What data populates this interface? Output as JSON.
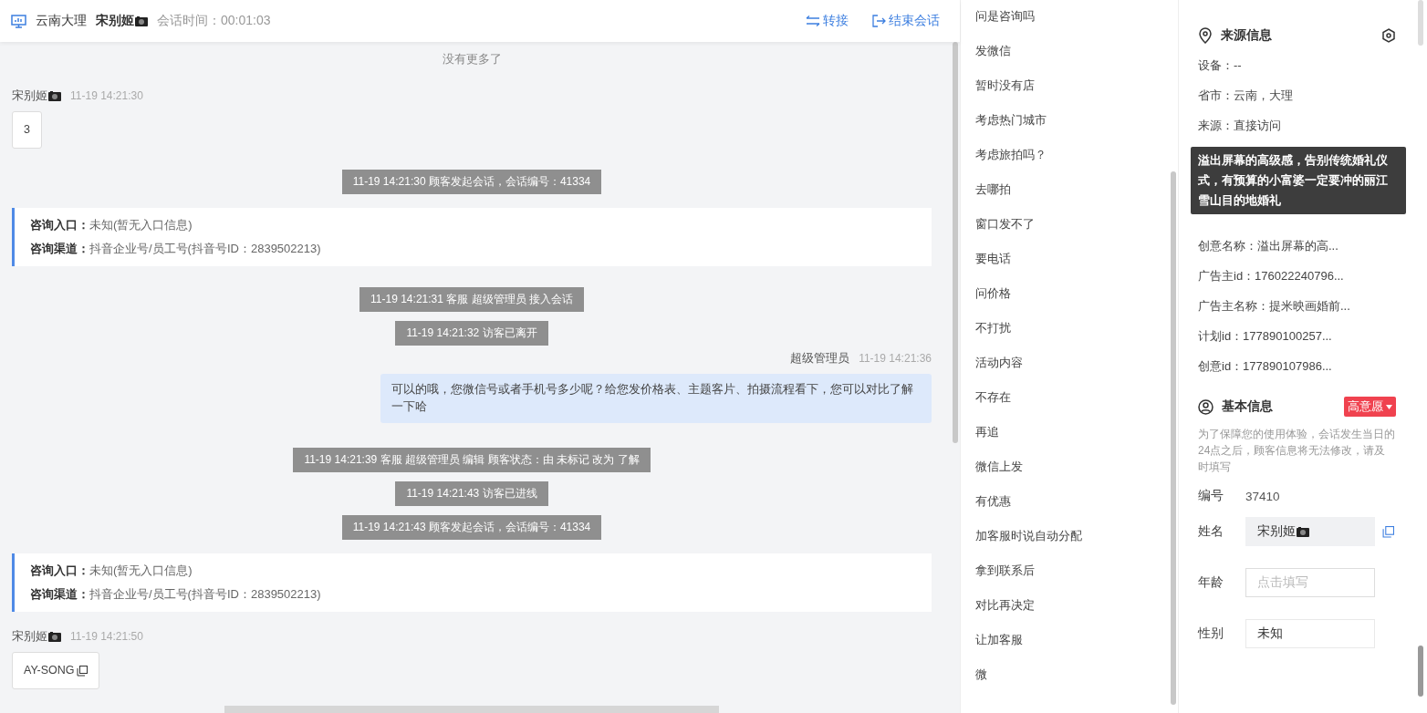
{
  "header": {
    "location": "云南大理",
    "visitor": "宋别姬",
    "duration_label": "会话时间：",
    "duration": "00:01:03",
    "actions": [
      {
        "kind": "transfer",
        "label": "转接"
      },
      {
        "kind": "end",
        "label": "结束会话"
      }
    ]
  },
  "messages": [
    {
      "kind": "notice",
      "text": "没有更多了"
    },
    {
      "kind": "customer",
      "name": "宋别姬",
      "time": "11-19 14:21:30",
      "text": "3",
      "copy": false
    },
    {
      "kind": "system",
      "text": "11-19 14:21:30 顾客发起会话，会话编号：41334"
    },
    {
      "kind": "entry",
      "lines": [
        {
          "label": "咨询入口：",
          "value": "未知(暂无入口信息)"
        },
        {
          "label": "咨询渠道：",
          "value": "抖音企业号/员工号(抖音号ID：2839502213)"
        }
      ]
    },
    {
      "kind": "system",
      "text": "11-19 14:21:31 客服 超级管理员 接入会话"
    },
    {
      "kind": "system",
      "text": "11-19 14:21:32 访客已离开"
    },
    {
      "kind": "agent",
      "name": "超级管理员",
      "time": "11-19 14:21:36",
      "text": "可以的哦，您微信号或者手机号多少呢？给您发价格表、主题客片、拍摄流程看下，您可以对比了解一下哈"
    },
    {
      "kind": "system",
      "text": "11-19 14:21:39 客服 超级管理员 编辑 顾客状态：由 未标记 改为 了解"
    },
    {
      "kind": "system",
      "text": "11-19 14:21:43 访客已进线"
    },
    {
      "kind": "system",
      "text": "11-19 14:21:43 顾客发起会话，会话编号：41334"
    },
    {
      "kind": "entry",
      "lines": [
        {
          "label": "咨询入口：",
          "value": "未知(暂无入口信息)"
        },
        {
          "label": "咨询渠道：",
          "value": "抖音企业号/员工号(抖音号ID：2839502213)"
        }
      ]
    },
    {
      "kind": "customer",
      "name": "宋别姬",
      "time": "11-19 14:21:50",
      "text": "AY-SONG",
      "copy": true
    },
    {
      "kind": "cut"
    }
  ],
  "quick_replies": [
    "问是咨询吗",
    "发微信",
    "暂时没有店",
    "考虑热门城市",
    "考虑旅拍吗？",
    "去哪拍",
    "窗口发不了",
    "要电话",
    "问价格",
    "不打扰",
    "活动内容",
    "不存在",
    "再追",
    "微信上发",
    "有优惠",
    "加客服时说自动分配",
    "拿到联系后",
    "对比再决定",
    "让加客服",
    "微"
  ],
  "source_info": {
    "title": "来源信息",
    "rows_before": [
      "设备：--",
      "省市：云南，大理",
      "来源：直接访问"
    ],
    "tooltip": "溢出屏幕的高级感，告别传统婚礼仪式，有预算的小富婆一定要冲的丽江雪山目的地婚礼",
    "rows_after": [
      "创意名称：溢出屏幕的高...",
      "广告主id：176022240796...",
      "广告主名称：提米映画婚前...",
      "计划id：177890100257...",
      "创意id：177890107986..."
    ]
  },
  "basic_info": {
    "title": "基本信息",
    "tag": {
      "label": "高意愿",
      "color": "#f0424f"
    },
    "note": "为了保障您的使用体验，会话发生当日的24点之后，顾客信息将无法修改，请及时填写",
    "fields": [
      {
        "kind": "text",
        "label": "编号",
        "value": "37410"
      },
      {
        "kind": "input",
        "label": "姓名",
        "value": "宋别姬",
        "camera": true,
        "copy": true,
        "filled": true
      },
      {
        "kind": "input",
        "label": "年龄",
        "placeholder": "点击填写",
        "filled": false
      },
      {
        "kind": "input",
        "label": "性别",
        "value": "未知",
        "filled": false
      }
    ]
  }
}
